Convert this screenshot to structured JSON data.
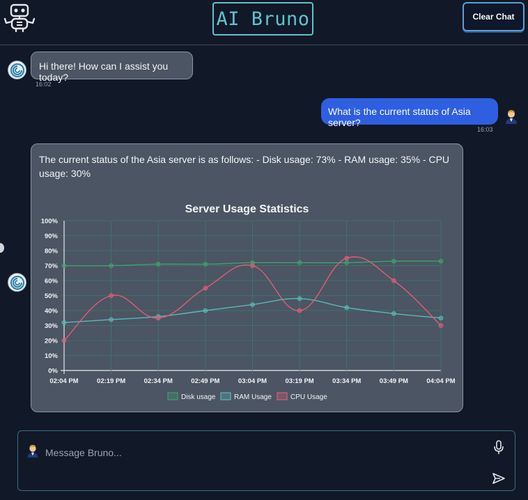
{
  "header": {
    "title": "AI Bruno",
    "clear_label": "Clear Chat",
    "logo_icon": "robot-icon"
  },
  "messages": [
    {
      "role": "bot",
      "text": "Hi there! How can I assist you today?",
      "time": "16:02"
    },
    {
      "role": "user",
      "text": "What is the current status of Asia server?",
      "time": "16:03"
    },
    {
      "role": "bot",
      "text": "The current status of the Asia server is as follows: - Disk usage: 73% - RAM usage: 35% - CPU usage: 30%"
    }
  ],
  "composer": {
    "placeholder": "Message Bruno...",
    "mic_icon": "microphone-icon",
    "send_icon": "send-icon"
  },
  "colors": {
    "background": "#111827",
    "accent": "#5fc3d0",
    "user_bubble": "#2f5fe0",
    "bot_bubble": "#4b5563"
  },
  "chart_data": {
    "type": "line",
    "title": "Server Usage Statistics",
    "categories": [
      "02:04 PM",
      "02:19 PM",
      "02:34 PM",
      "02:49 PM",
      "03:04 PM",
      "03:19 PM",
      "03:34 PM",
      "03:49 PM",
      "04:04 PM"
    ],
    "yticks": [
      "0%",
      "10%",
      "20%",
      "30%",
      "40%",
      "50%",
      "60%",
      "70%",
      "80%",
      "90%",
      "100%"
    ],
    "ylim": [
      0,
      100
    ],
    "grid": true,
    "legend_position": "bottom",
    "series": [
      {
        "name": "Disk usage",
        "color": "#3fa06e",
        "values": [
          70,
          70,
          71,
          71,
          72,
          72,
          72,
          73,
          73
        ]
      },
      {
        "name": "RAM Usage",
        "color": "#5ab8b8",
        "values": [
          32,
          34,
          36,
          40,
          44,
          48,
          42,
          38,
          35
        ]
      },
      {
        "name": "CPU Usage",
        "color": "#e05c78",
        "values": [
          20,
          50,
          35,
          55,
          70,
          40,
          75,
          60,
          30
        ]
      }
    ]
  }
}
